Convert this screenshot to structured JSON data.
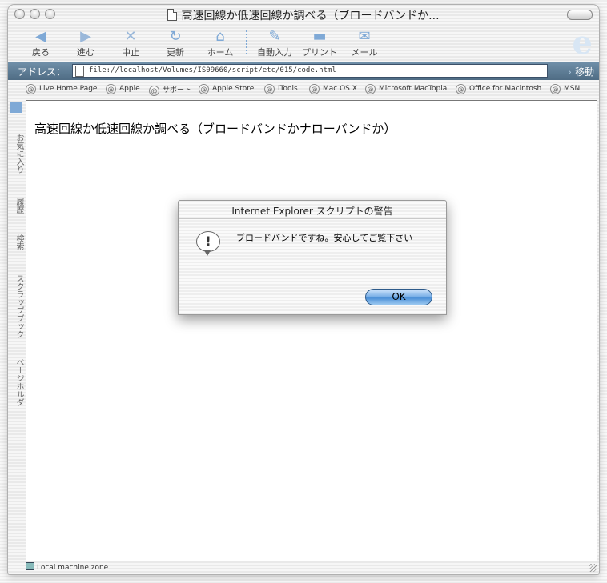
{
  "window": {
    "title": "高速回線か低速回線か調べる（ブロードバンドか..."
  },
  "toolbar": {
    "back": "戻る",
    "forward": "進む",
    "stop": "中止",
    "refresh": "更新",
    "home": "ホーム",
    "autofill": "自動入力",
    "print": "プリント",
    "mail": "メール"
  },
  "address": {
    "label": "アドレス：",
    "url": "file://localhost/Volumes/IS09660/script/etc/015/code.html",
    "go": "移動"
  },
  "favorites": [
    "Live Home Page",
    "Apple",
    "サポート",
    "Apple Store",
    "iTools",
    "Mac OS X",
    "Microsoft MacTopia",
    "Office for Macintosh",
    "MSN"
  ],
  "sidetabs": [
    "お気に入り",
    "履歴",
    "検索",
    "スクラップブック",
    "ページホルダ"
  ],
  "page": {
    "heading": "高速回線か低速回線か調べる（ブロードバンドかナローバンドか）"
  },
  "dialog": {
    "title": "Internet Explorer スクリプトの警告",
    "message": "ブロードバンドですね。安心してご覧下さい",
    "ok_label": "OK"
  },
  "status": {
    "zone": "Local machine zone"
  },
  "colors": {
    "accent": "#7fa9d6",
    "address_bar": "#5a7890",
    "ok_button": "#4b8fd7"
  }
}
